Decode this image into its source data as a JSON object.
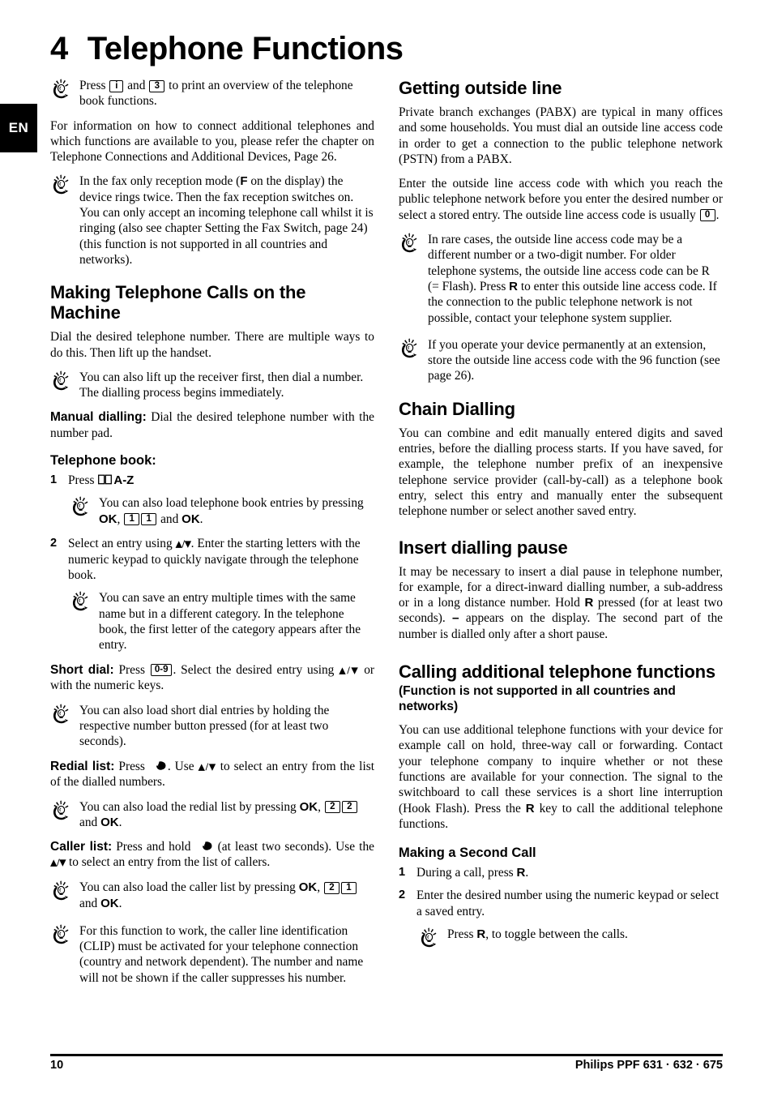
{
  "page": {
    "language_tab": "EN",
    "chapter_number": "4",
    "chapter_title": "Telephone Functions",
    "footer_page_number": "10",
    "footer_product": "Philips PPF 631 · 632 · 675"
  },
  "left_column": {
    "tip_print_overview": {
      "pre": "Press",
      "key1": "i",
      "mid": "and",
      "key2": "3",
      "post": "to print an overview of the telephone book functions."
    },
    "para_connect_phones": "For information on how to connect additional telephones and which functions are available to you, please refer the chapter on Telephone Connections and Additional Devices, Page 26.",
    "tip_fax_only": {
      "pre": "In the fax only reception mode (",
      "key_F": "F",
      "post": " on the display) the device rings twice. Then the fax reception switches on. You can only accept an incoming telephone call whilst it is ringing (also see chapter Setting the Fax Switch, page 24) (this function is not supported in all countries and networks)."
    },
    "heading_making_calls": "Making Telephone Calls on the Machine",
    "para_dial_desired": "Dial the desired telephone number. There are multiple ways to do this. Then lift up the handset.",
    "tip_lift_receiver": "You can also lift up the receiver first, then dial a number. The dialling process begins immediately.",
    "manual_dialling": {
      "label": "Manual dialling:",
      "text": " Dial the desired telephone number with the number pad."
    },
    "telephone_book_label": "Telephone book:",
    "step1": {
      "num": "1",
      "pre": "Press",
      "icon": "book-icon",
      "post": "A-Z"
    },
    "tip_load_phonebook": {
      "pre": "You can also load telephone book entries by pressing",
      "ok1": "OK",
      "comma": ",",
      "key1": "1",
      "key2": "1",
      "mid": "and",
      "ok2": "OK",
      "period": "."
    },
    "step2": {
      "num": "2",
      "pre": "Select an entry using",
      "arrows": "▲/▼",
      "post": ". Enter the starting letters with the numeric keypad to quickly navigate through the telephone book."
    },
    "tip_save_multiple": "You can save an entry multiple times with the same name but in a different category. In the telephone book, the first letter of the category appears after the entry.",
    "short_dial": {
      "label": "Short dial:",
      "pre": " Press",
      "key": "0-9",
      "mid": ". Select the desired entry using",
      "arrows": "▲/▼",
      "post": " or with the numeric keys."
    },
    "tip_short_dial": "You can also load short dial entries by holding the respective number button pressed (for at least two seconds).",
    "redial_list": {
      "label": "Redial list:",
      "pre": " Press",
      "icon": "redial-icon",
      "mid": ". Use",
      "arrows": "▲/▼",
      "post": " to select an entry from the list of the dialled numbers."
    },
    "tip_load_redial": {
      "pre": "You can also load the redial list by pressing",
      "ok1": "OK",
      "comma": ",",
      "key1": "2",
      "key2": "2",
      "mid": "and",
      "ok2": "OK",
      "period": "."
    },
    "caller_list": {
      "label": "Caller list:",
      "pre": " Press and hold",
      "icon": "redial-icon",
      "mid": " (at least two seconds). Use the",
      "arrows": "▲/▼",
      "post": " to select an entry from the list of callers."
    },
    "tip_load_caller": {
      "pre": "You can also load the caller list by pressing",
      "ok1": "OK",
      "comma": ",",
      "key1": "2",
      "key2": "1",
      "mid": "and",
      "ok2": "OK",
      "period": "."
    },
    "tip_clip": "For this function to work, the caller line identification (CLIP) must be activated for your telephone connection (country and network dependent). The number and name will not be shown if the caller suppresses his number."
  },
  "right_column": {
    "heading_getting_outside_line": "Getting outside line",
    "para_pabx": "Private branch exchanges (PABX) are typical in many offices and some households. You must dial an outside line access code in order to get a connection to the public telephone network (PSTN) from a PABX.",
    "para_enter_code": {
      "pre": "Enter the outside line access code with which you reach the public telephone network before you enter the desired number or select a stored entry. The outside line access code is usually",
      "key": "0",
      "post": "."
    },
    "tip_rare_cases": {
      "pre": "In rare cases, the outside line access code may be a different number or a two-digit number. For older telephone systems, the outside line access code can be R (= Flash). Press ",
      "keyR": "R",
      "post": " to enter this outside line access code. If the connection to the public telephone network is not possible, contact your telephone system supplier."
    },
    "tip_extension": "If you operate your device permanently at an extension, store the outside line access code with the 96 function (see page 26).",
    "heading_chain_dialling": "Chain Dialling",
    "para_chain": "You can combine and edit manually entered digits and saved entries, before the dialling process starts. If you have saved, for example, the telephone number prefix of an inexpensive telephone service provider (call-by-call) as a telephone book entry, select this entry and manually enter the subsequent telephone number or select another saved entry.",
    "heading_insert_pause": "Insert dialling pause",
    "para_pause": {
      "pre": "It may be necessary to insert a dial pause in telephone number, for example, for a direct-inward dialling number, a sub-address or in a long distance number. Hold ",
      "keyR": "R",
      "mid": " pressed (for at least two seconds). ",
      "dash": "–",
      "post": " appears on the display. The second part of the number is dialled only after a short pause."
    },
    "heading_calling_additional": "Calling additional telephone functions",
    "subheading_not_supported": "(Function is not supported in all countries and networks)",
    "para_additional": {
      "pre": "You can use additional telephone functions with your device for example call on hold, three-way call or forwarding. Contact your telephone company to inquire whether or not these functions are available for your connection. The signal to the switchboard to call these services is a short line interruption (Hook Flash). Press the ",
      "keyR": "R",
      "post": " key to call the additional telephone functions."
    },
    "heading_second_call": "Making a Second Call",
    "second_call_step1": {
      "num": "1",
      "pre": "During a call, press ",
      "keyR": "R",
      "post": "."
    },
    "second_call_step2": {
      "num": "2",
      "text": "Enter the desired number using the numeric keypad or select a saved entry."
    },
    "tip_toggle": {
      "pre": "Press ",
      "keyR": "R",
      "post": ", to toggle between the calls."
    }
  },
  "icons": {
    "hint": "hand-lightbulb-hint-icon",
    "book": "open-book-icon",
    "redial": "redial-circle-icon"
  },
  "colors": {
    "text": "#000000",
    "tab_background": "#000000",
    "tab_text": "#ffffff",
    "page_background": "#ffffff"
  }
}
